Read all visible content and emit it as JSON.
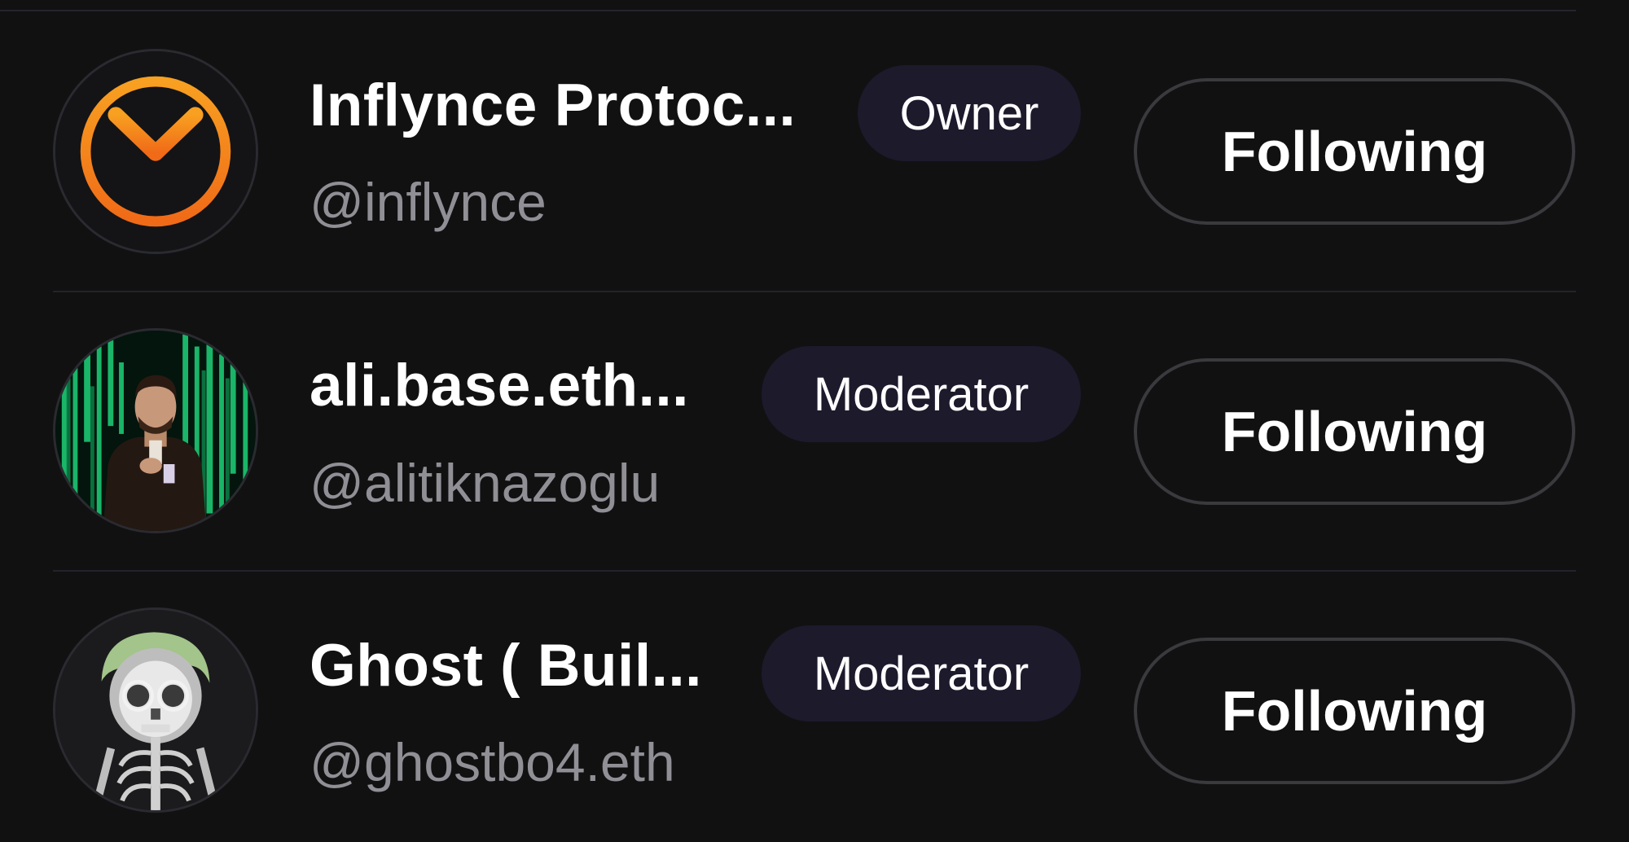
{
  "members": [
    {
      "name": "Inflynce Protoc...",
      "handle": "@inflynce",
      "role": "Owner",
      "button_label": "Following",
      "avatar_icon": "inflynce-logo-icon"
    },
    {
      "name": "ali.base.eth...",
      "handle": "@alitiknazoglu",
      "role": "Moderator",
      "button_label": "Following",
      "avatar_icon": "user-photo-avatar"
    },
    {
      "name": "Ghost ( Buil...",
      "handle": "@ghostbo4.eth",
      "role": "Moderator",
      "button_label": "Following",
      "avatar_icon": "skeleton-avatar"
    }
  ],
  "colors": {
    "background": "#111112",
    "badge_bg": "#1d1a2c",
    "handle_text": "#8f8f95",
    "logo_orange": "#f5861f"
  }
}
